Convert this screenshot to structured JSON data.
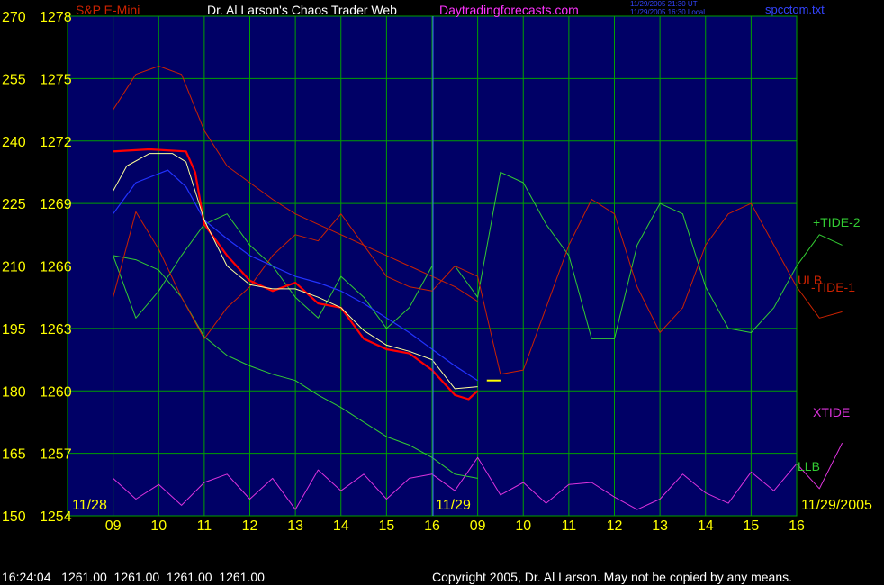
{
  "header": {
    "instrument": "S&P E-Mini",
    "title": "Dr. Al Larson's Chaos Trader Web",
    "site": "Daytradingforecasts.com",
    "timestamp_ut": "11/29/2005 21:30 UT",
    "timestamp_local": "11/29/2005 16:30 Local",
    "file": "spcctom.txt"
  },
  "footer": {
    "status": "16:24:04   1261.00  1261.00  1261.00  1261.00",
    "copyright": "Copyright 2005, Dr. Al Larson. May not be copied by any means."
  },
  "colors": {
    "background": "#000066",
    "grid": "#00a000",
    "yellow": "#ffff00",
    "price": "#ff0000",
    "green_tide": "#33cc33",
    "red_tide": "#cc2200",
    "xtide": "#dd33dd",
    "ma_blue": "#2233ff",
    "ma_white": "#ffff99",
    "site": "#ff33ff",
    "file": "#3344ff"
  },
  "chart_data": {
    "type": "line",
    "xlabel": "",
    "ylabel": "",
    "left_axis_ticks": [
      "270",
      "255",
      "240",
      "225",
      "210",
      "195",
      "180",
      "165",
      "150"
    ],
    "price_axis_ticks": [
      "1278",
      "1275",
      "1272",
      "1269",
      "1266",
      "1263",
      "1260",
      "1257",
      "1254"
    ],
    "ylim": [
      1254,
      1278
    ],
    "time_ticks": [
      "09",
      "10",
      "11",
      "12",
      "13",
      "14",
      "15",
      "16",
      "09",
      "10",
      "11",
      "12",
      "13",
      "14",
      "15",
      "16"
    ],
    "date_labels": [
      "11/28",
      "11/29",
      "11/29/2005"
    ],
    "legend": [
      "+TIDE-2",
      "ULB",
      "-TIDE-1",
      "XTIDE",
      "LLB"
    ],
    "series": [
      {
        "name": "price",
        "x": [
          0,
          0.8,
          1.6,
          1.8,
          2.0,
          2.5,
          3.0,
          3.5,
          4.0,
          4.5,
          5.0,
          5.5,
          6.0,
          6.5,
          7.0,
          7.5,
          7.8,
          8.0
        ],
        "y": [
          1271.5,
          1271.6,
          1271.5,
          1270.5,
          1268.0,
          1266.5,
          1265.3,
          1264.8,
          1265.2,
          1264.2,
          1264.0,
          1262.5,
          1262.0,
          1261.8,
          1261.0,
          1259.8,
          1259.6,
          1260.0
        ]
      },
      {
        "name": "+TIDE-2",
        "x": [
          0,
          0.5,
          1,
          1.5,
          2,
          2.5,
          3,
          3.5,
          4,
          4.5,
          5,
          5.5,
          6,
          6.5,
          7,
          7.5,
          8,
          8.5,
          9,
          9.5,
          10,
          10.5,
          11,
          11.5,
          12,
          12.5,
          13,
          13.5,
          14,
          14.5,
          15,
          15.5,
          16
        ],
        "y": [
          1266.5,
          1263.5,
          1264.8,
          1266.5,
          1268.0,
          1268.5,
          1267.0,
          1266.0,
          1264.5,
          1263.5,
          1265.5,
          1264.5,
          1263.0,
          1264.0,
          1266.0,
          1266.0,
          1264.5,
          1270.5,
          1270.0,
          1268.0,
          1266.5,
          1262.5,
          1262.5,
          1267.0,
          1269.0,
          1268.5,
          1265.0,
          1263.0,
          1262.8,
          1264.0,
          1266.0,
          1267.5,
          1267.0
        ]
      },
      {
        "name": "ULB",
        "x": [
          0,
          0.5,
          1,
          1.5,
          2,
          2.5,
          3,
          3.5,
          4,
          4.5,
          5,
          5.5,
          6,
          6.5,
          7,
          7.5,
          8
        ],
        "y": [
          1273.5,
          1275.2,
          1275.6,
          1275.2,
          1272.5,
          1270.8,
          1270.0,
          1269.2,
          1268.5,
          1268.0,
          1267.5,
          1267.0,
          1266.5,
          1266.0,
          1265.5,
          1265.0,
          1264.3
        ]
      },
      {
        "name": "-TIDE-1",
        "x": [
          0,
          0.5,
          1,
          1.5,
          2,
          2.5,
          3,
          3.5,
          4,
          4.5,
          5,
          5.5,
          6,
          6.5,
          7,
          7.5,
          8,
          8.5,
          9,
          9.5,
          10,
          10.5,
          11,
          11.5,
          12,
          12.5,
          13,
          13.5,
          14,
          14.5,
          15,
          15.5,
          16
        ],
        "y": [
          1264.5,
          1268.6,
          1266.8,
          1264.5,
          1262.5,
          1264.0,
          1265.0,
          1266.5,
          1267.5,
          1267.2,
          1268.5,
          1267.0,
          1265.5,
          1265.0,
          1264.8,
          1266.0,
          1265.5,
          1260.8,
          1261.0,
          1264.0,
          1267.0,
          1269.2,
          1268.5,
          1265.0,
          1262.8,
          1264.0,
          1267.0,
          1268.5,
          1269.0,
          1267.0,
          1265.0,
          1263.5,
          1263.8
        ]
      },
      {
        "name": "LLB",
        "x": [
          0,
          0.5,
          1,
          1.5,
          2,
          2.5,
          3,
          3.5,
          4,
          4.5,
          5,
          5.5,
          6,
          6.5,
          7,
          7.5,
          8
        ],
        "y": [
          1266.5,
          1266.3,
          1265.8,
          1264.5,
          1262.6,
          1261.7,
          1261.2,
          1260.8,
          1260.5,
          1259.8,
          1259.2,
          1258.5,
          1257.8,
          1257.4,
          1256.8,
          1256.0,
          1255.8
        ]
      },
      {
        "name": "XTIDE",
        "x": [
          0,
          0.5,
          1,
          1.5,
          2,
          2.5,
          3,
          3.5,
          4,
          4.5,
          5,
          5.5,
          6,
          6.5,
          7,
          7.5,
          8,
          8.5,
          9,
          9.5,
          10,
          10.5,
          11,
          11.5,
          12,
          12.5,
          13,
          13.5,
          14,
          14.5,
          15,
          15.5,
          16
        ],
        "y": [
          1255.8,
          1254.8,
          1255.5,
          1254.5,
          1255.6,
          1256.0,
          1254.8,
          1255.8,
          1254.3,
          1256.2,
          1255.2,
          1256.0,
          1254.8,
          1255.8,
          1256.0,
          1255.2,
          1256.8,
          1255.0,
          1255.6,
          1254.6,
          1255.5,
          1255.6,
          1254.9,
          1254.3,
          1254.8,
          1256.0,
          1255.1,
          1254.6,
          1256.1,
          1255.2,
          1256.5,
          1255.3,
          1257.5
        ]
      },
      {
        "name": "ma_blue",
        "x": [
          0,
          0.5,
          1.2,
          1.6,
          2,
          2.5,
          3,
          3.5,
          4,
          4.5,
          5,
          5.5,
          6,
          6.5,
          7,
          7.5,
          8
        ],
        "y": [
          1268.5,
          1270.0,
          1270.6,
          1269.8,
          1268.2,
          1267.3,
          1266.5,
          1266.0,
          1265.5,
          1265.2,
          1264.8,
          1264.2,
          1263.5,
          1262.8,
          1262.0,
          1261.2,
          1260.5
        ]
      },
      {
        "name": "ma_white",
        "x": [
          0,
          0.3,
          0.8,
          1.3,
          1.6,
          2,
          2.5,
          3,
          3.5,
          4,
          4.5,
          5,
          5.5,
          6,
          6.5,
          7,
          7.5,
          8
        ],
        "y": [
          1269.6,
          1270.8,
          1271.4,
          1271.4,
          1271.0,
          1268.2,
          1266.0,
          1265.1,
          1264.9,
          1264.9,
          1264.5,
          1264.0,
          1262.9,
          1262.2,
          1261.9,
          1261.5,
          1260.1,
          1260.2
        ]
      }
    ],
    "annotations": [
      {
        "type": "projection_dash",
        "value": 1260.5,
        "color": "yellow"
      }
    ]
  }
}
